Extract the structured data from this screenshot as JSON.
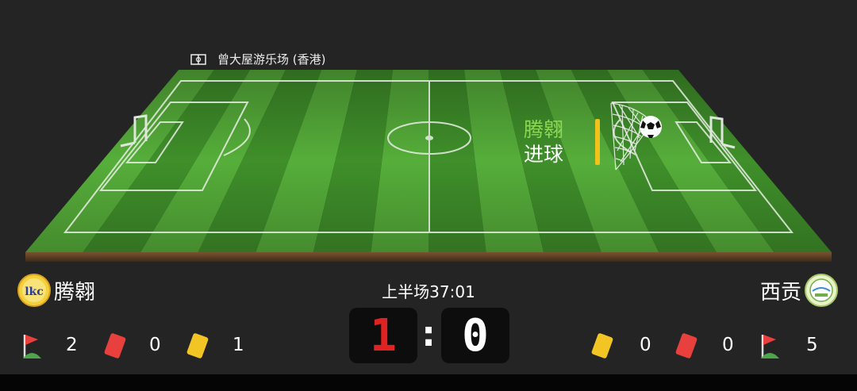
{
  "venue": {
    "name": "曾大屋游乐场 (香港)",
    "icon": "stadium-icon"
  },
  "event": {
    "team": "腾翱",
    "action": "进球",
    "icon": "goal-net-icon"
  },
  "home": {
    "name": "腾翱",
    "score": "1",
    "corners": "2",
    "red_cards": "0",
    "yellow_cards": "1",
    "logo": "lkc-club-logo"
  },
  "away": {
    "name": "西贡",
    "score": "0",
    "corners": "5",
    "red_cards": "0",
    "yellow_cards": "0",
    "logo": "saikung-club-logo"
  },
  "match": {
    "period_time": "上半场37:01"
  },
  "colors": {
    "home_score": "#e02222",
    "away_score": "#ffffff",
    "event_team": "#8ed853",
    "event_bar": "#f1c21b",
    "pitch_light": "#56ae3a",
    "pitch_dark": "#3f8f2a",
    "red_card": "#e8403c",
    "yellow_card": "#f2c424"
  }
}
